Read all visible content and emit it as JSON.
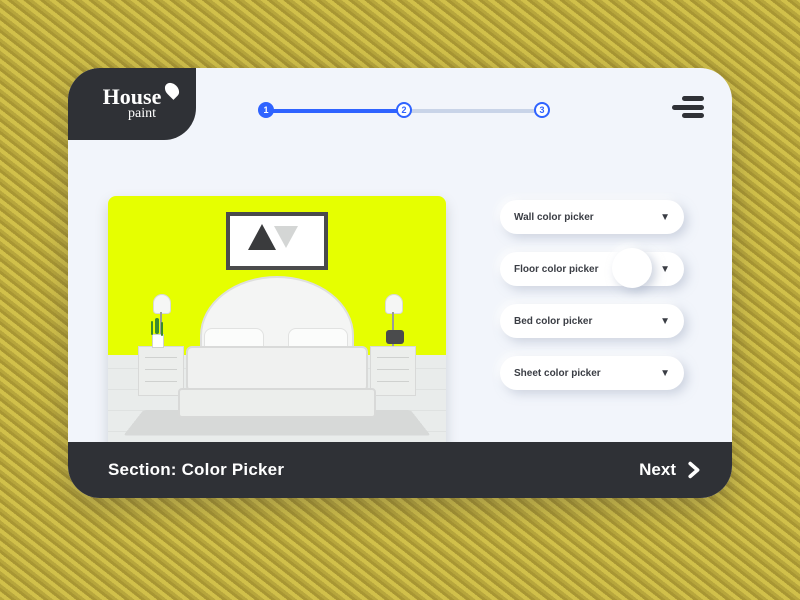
{
  "brand": {
    "line1": "House",
    "line2": "paint"
  },
  "stepper": {
    "steps": [
      "1",
      "2",
      "3"
    ],
    "active": 2
  },
  "pickers": [
    {
      "label": "Wall color picker",
      "swatch": null
    },
    {
      "label": "Floor color picker",
      "swatch": "#ffffff"
    },
    {
      "label": "Bed color picker",
      "swatch": null
    },
    {
      "label": "Sheet color picker",
      "swatch": null
    }
  ],
  "footer": {
    "section_label": "Section: Color Picker",
    "next_label": "Next"
  },
  "preview": {
    "wall_color": "#e6ff00"
  }
}
